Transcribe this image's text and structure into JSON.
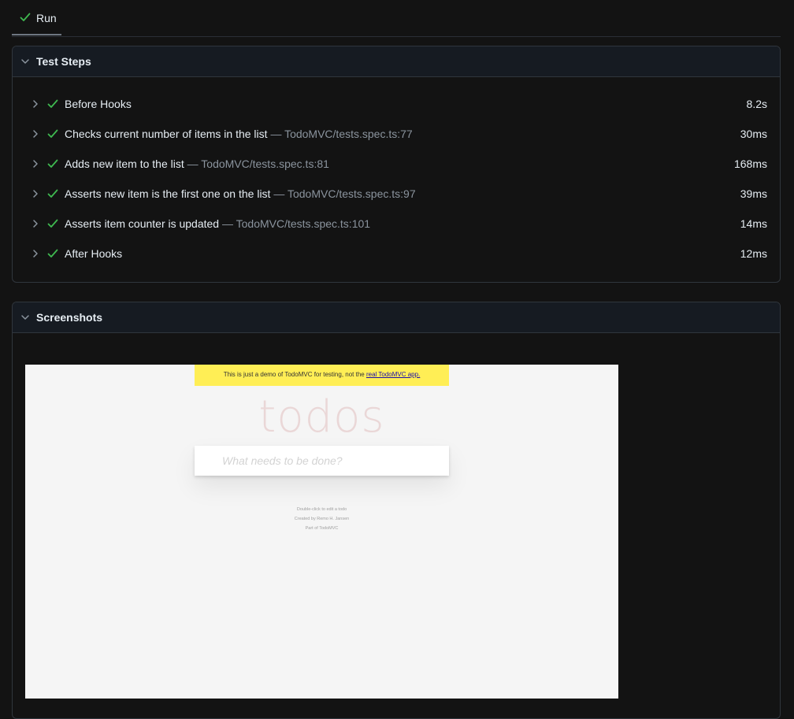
{
  "tab": {
    "label": "Run"
  },
  "steps_panel": {
    "title": "Test Steps",
    "steps": [
      {
        "name": "Before Hooks",
        "location": "",
        "duration": "8.2s"
      },
      {
        "name": "Checks current number of items in the list",
        "location": "— TodoMVC/tests.spec.ts:77",
        "duration": "30ms"
      },
      {
        "name": "Adds new item to the list",
        "location": "— TodoMVC/tests.spec.ts:81",
        "duration": "168ms"
      },
      {
        "name": "Asserts new item is the first one on the list",
        "location": "— TodoMVC/tests.spec.ts:97",
        "duration": "39ms"
      },
      {
        "name": "Asserts item counter is updated",
        "location": "— TodoMVC/tests.spec.ts:101",
        "duration": "14ms"
      },
      {
        "name": "After Hooks",
        "location": "",
        "duration": "12ms"
      }
    ]
  },
  "screenshots_panel": {
    "title": "Screenshots",
    "screenshot": {
      "banner_text": "This is just a demo of TodoMVC for testing, not the ",
      "banner_link": "real TodoMVC app.",
      "app_title": "todos",
      "input_placeholder": "What needs to be done?",
      "footer": [
        "Double-click to edit a todo",
        "Created by Remo H. Jansen",
        "Part of TodoMVC"
      ]
    }
  },
  "colors": {
    "success": "#3fb950",
    "background": "#131313",
    "panel_header": "#161b22",
    "muted_text": "#8b949e"
  }
}
